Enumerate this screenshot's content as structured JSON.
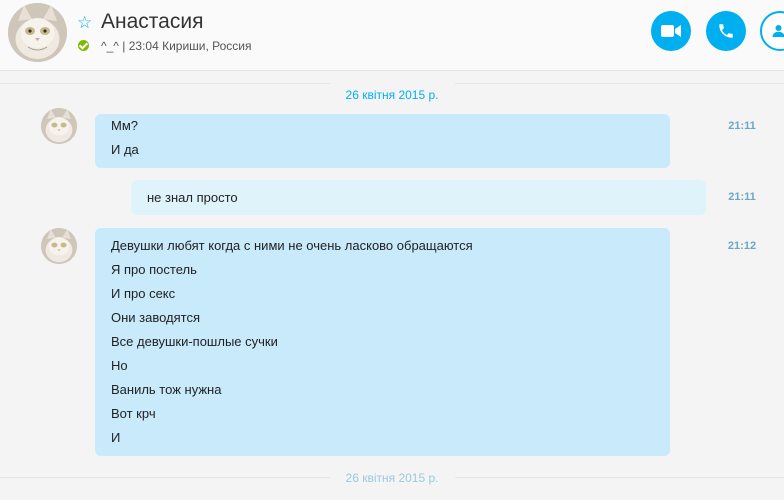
{
  "header": {
    "contact_name": "Анастасия",
    "mood": "^_^ | 23:04 Кириши, Россия",
    "status_color": "#7fba00",
    "accent_color": "#00aff0",
    "buttons": [
      "video-call-icon",
      "audio-call-icon",
      "add-contact-icon"
    ]
  },
  "conversation": {
    "date_top": "26 квітня 2015 р.",
    "date_bottom": "26 квітня 2015 р.",
    "messages": [
      {
        "direction": "in",
        "time": "21:11",
        "lines": [
          "Мм?",
          "И да"
        ]
      },
      {
        "direction": "out",
        "time": "21:11",
        "lines": [
          "не знал просто"
        ]
      },
      {
        "direction": "in",
        "time": "21:12",
        "lines": [
          "Девушки любят когда с ними не очень ласково обращаются",
          "Я про постель",
          "И про секс",
          "Они заводятся",
          "Все девушки-пошлые сучки",
          "Но",
          "Ваниль тож нужна",
          "Вот крч",
          "И"
        ]
      }
    ]
  }
}
